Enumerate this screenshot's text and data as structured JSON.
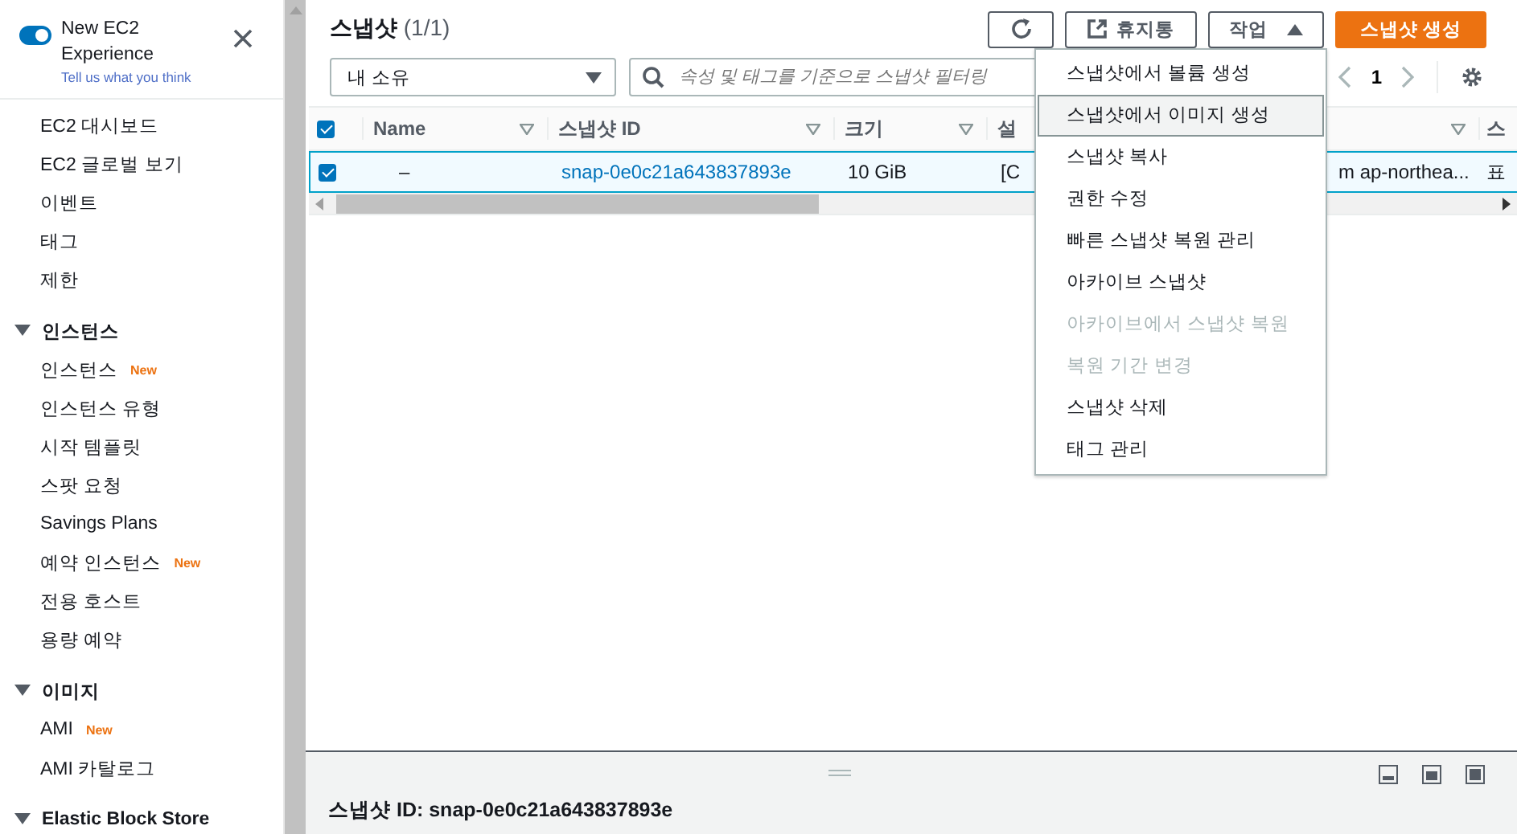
{
  "sidebar": {
    "toggle": {
      "on": true,
      "label": "New EC2 Experience",
      "link": "Tell us what you think"
    },
    "items": [
      {
        "label": "EC2 대시보드"
      },
      {
        "label": "EC2 글로벌 보기"
      },
      {
        "label": "이벤트"
      },
      {
        "label": "태그"
      },
      {
        "label": "제한"
      }
    ],
    "sections": [
      {
        "title": "인스턴스",
        "expanded": true,
        "items": [
          {
            "label": "인스턴스",
            "badge": "New"
          },
          {
            "label": "인스턴스 유형"
          },
          {
            "label": "시작 템플릿"
          },
          {
            "label": "스팟 요청"
          },
          {
            "label": "Savings Plans"
          },
          {
            "label": "예약 인스턴스",
            "badge": "New"
          },
          {
            "label": "전용 호스트"
          },
          {
            "label": "용량 예약"
          }
        ]
      },
      {
        "title": "이미지",
        "expanded": true,
        "items": [
          {
            "label": "AMI",
            "badge": "New"
          },
          {
            "label": "AMI 카탈로그"
          }
        ]
      },
      {
        "title": "Elastic Block Store",
        "expanded": true
      }
    ]
  },
  "header": {
    "title": "스냅샷",
    "count": "(1/1)",
    "buttons": [
      {
        "kind": "refresh"
      },
      {
        "kind": "external",
        "label": "휴지통"
      },
      {
        "kind": "dropdown",
        "label": "작업",
        "expanded": true
      },
      {
        "kind": "primary",
        "label": "스냅샷 생성"
      }
    ]
  },
  "filter": {
    "value": "내 소유",
    "search_placeholder": "속성 및 태그를 기준으로 스냅샷 필터링"
  },
  "pagination": {
    "page": "1"
  },
  "table": {
    "all_checked": true,
    "columns": [
      {
        "label": "Name",
        "sort_icon": true
      },
      {
        "label": "스냅샷 ID",
        "sort_icon": true
      },
      {
        "label": "크기",
        "sort_icon": true
      },
      {
        "label": "설",
        "sort_icon": false
      },
      {
        "sort_icon": true
      },
      {
        "label": "스",
        "sort_icon": false
      }
    ],
    "rows": [
      {
        "selected": true,
        "cells": [
          "–",
          "snap-0e0c21a643837893e",
          "10 GiB",
          "[C",
          "m ap-northea...",
          "표"
        ]
      }
    ]
  },
  "menu": {
    "items": [
      {
        "label": "스냅샷에서 볼륨 생성",
        "disabled": false,
        "selected": false
      },
      {
        "label": "스냅샷에서 이미지 생성",
        "disabled": false,
        "selected": true
      },
      {
        "label": "스냅샷 복사",
        "disabled": false,
        "selected": false
      },
      {
        "label": "권한 수정",
        "disabled": false,
        "selected": false
      },
      {
        "label": "빠른 스냅샷 복원 관리",
        "disabled": false,
        "selected": false
      },
      {
        "label": "아카이브 스냅샷",
        "disabled": false,
        "selected": false
      },
      {
        "label": "아카이브에서 스냅샷 복원",
        "disabled": true,
        "selected": false
      },
      {
        "label": "복원 기간 변경",
        "disabled": true,
        "selected": false
      },
      {
        "label": "스냅샷 삭제",
        "disabled": false,
        "selected": false
      },
      {
        "label": "태그 관리",
        "disabled": false,
        "selected": false
      }
    ]
  },
  "detail": {
    "title": "스냅샷 ID: snap-0e0c21a643837893e"
  }
}
